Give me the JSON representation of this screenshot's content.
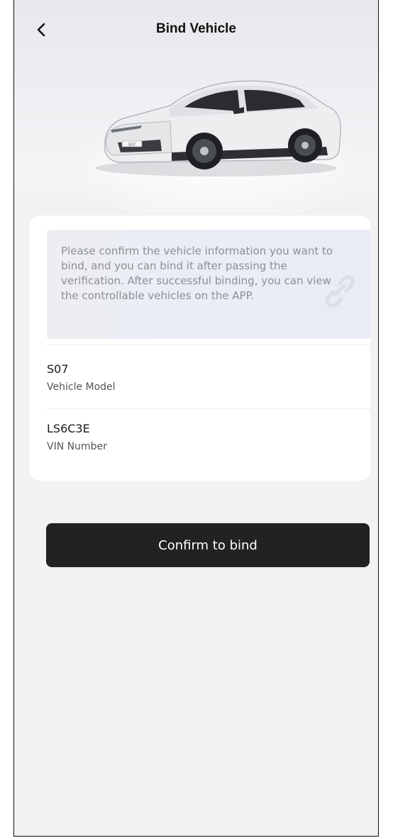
{
  "header": {
    "title": "Bind Vehicle",
    "back_icon": "chevron-left-icon"
  },
  "hero": {
    "car_badge": "S07"
  },
  "notice": {
    "text": "Please confirm the vehicle information you want to bind, and you can bind it after passing the verification. After successful binding, you can view the controllable vehicles on the APP.",
    "icon": "link-icon"
  },
  "vehicle": {
    "model_value": "S07",
    "model_label": "Vehicle Model",
    "vin_value": "LS6C3E",
    "vin_label": "VIN Number"
  },
  "actions": {
    "confirm_label": "Confirm to bind"
  },
  "colors": {
    "background": "#f2f2f4",
    "card": "#ffffff",
    "button": "#222225",
    "notice_text": "#8d8f95"
  }
}
